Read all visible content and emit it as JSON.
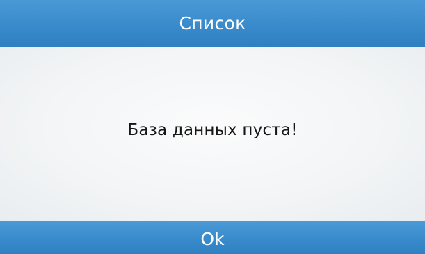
{
  "dialog": {
    "title": "Список",
    "message": "База данных пуста!",
    "ok_label": "Ok"
  },
  "colors": {
    "header_blue": "#3a8bcb",
    "content_bg": "#f3f5f6",
    "text_dark": "#161616",
    "text_light": "#ffffff"
  }
}
